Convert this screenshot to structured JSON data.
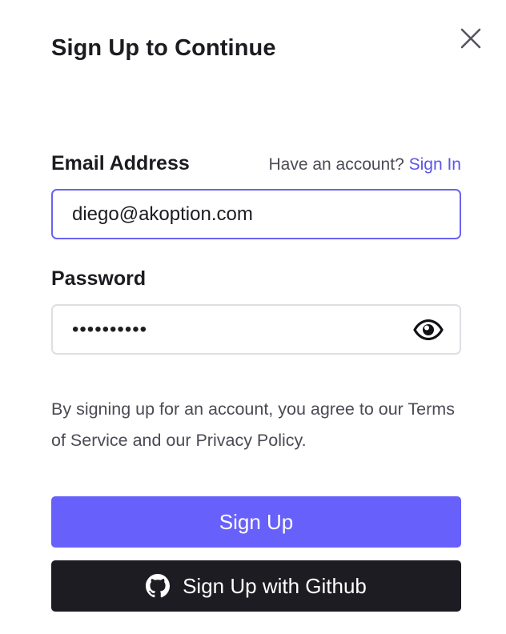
{
  "modal": {
    "title": "Sign Up to Continue"
  },
  "email": {
    "label": "Email Address",
    "value": "diego@akoption.com"
  },
  "account": {
    "prompt": "Have an account?",
    "signin_label": "Sign In"
  },
  "password": {
    "label": "Password",
    "masked_value": "••••••••••"
  },
  "legal": {
    "text": "By signing up for an account, you agree to our Terms of Service and our Privacy Policy."
  },
  "buttons": {
    "signup_label": "Sign Up",
    "github_label": "Sign Up with Github"
  },
  "icons": {
    "close": "close-icon",
    "eye": "eye-icon",
    "github": "github-icon"
  },
  "colors": {
    "accent": "#6860fa",
    "focus_border": "#6a63ef",
    "link": "#5b55e8",
    "github_button": "#1c1c22"
  }
}
